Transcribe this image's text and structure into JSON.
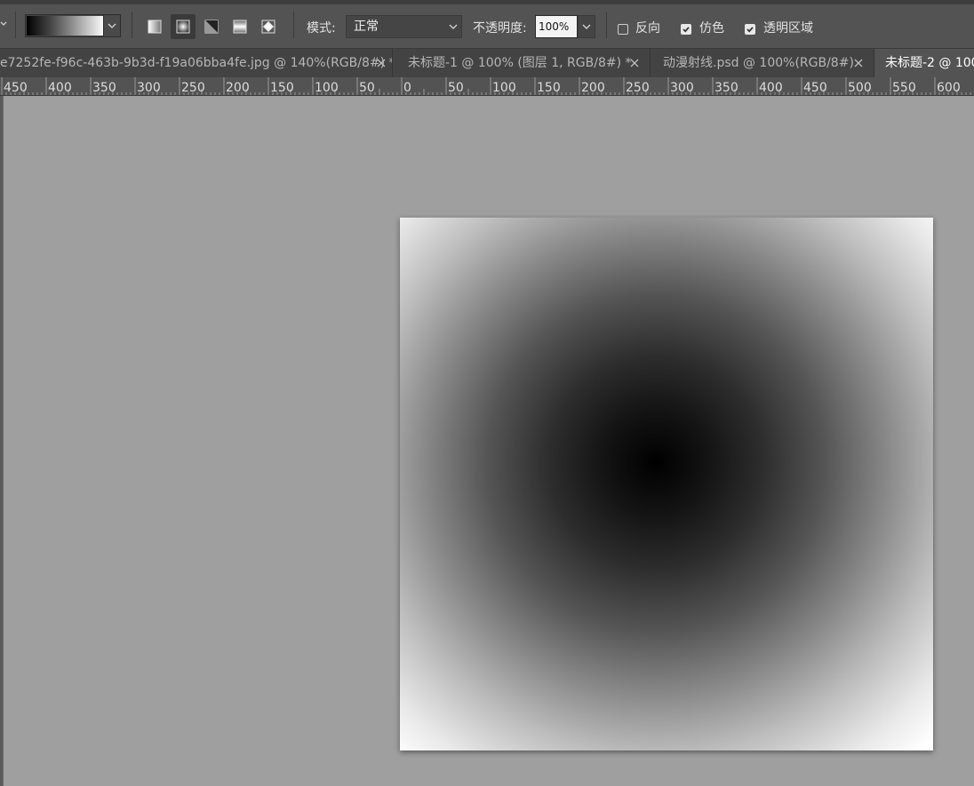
{
  "options_bar": {
    "gradient_types": [
      "linear",
      "radial",
      "angle",
      "reflected",
      "diamond"
    ],
    "active_gradient_type": "radial",
    "mode_label": "模式:",
    "mode_value": "正常",
    "opacity_label": "不透明度:",
    "opacity_value": "100%",
    "reverse_label": "反向",
    "reverse_checked": false,
    "dither_label": "仿色",
    "dither_checked": true,
    "transparency_label": "透明区域",
    "transparency_checked": true
  },
  "tabs": [
    {
      "title": "e7252fe-f96c-463b-9b3d-f19a06bba4fe.jpg @ 140%(RGB/8#) *",
      "active": false
    },
    {
      "title": "未标题-1 @ 100% (图层 1, RGB/8#) *",
      "active": false
    },
    {
      "title": "动漫射线.psd @ 100%(RGB/8#)",
      "active": false
    },
    {
      "title": "未标题-2 @ 100",
      "active": true
    }
  ],
  "ruler": {
    "labels": [
      "450",
      "400",
      "350",
      "300",
      "250",
      "200",
      "150",
      "100",
      "50",
      "0",
      "50",
      "100",
      "150",
      "200",
      "250",
      "300",
      "350",
      "400",
      "450",
      "500",
      "550",
      "600"
    ]
  },
  "colors": {
    "workspace": "#9f9f9f",
    "panel": "#535353",
    "tab_bar": "#434343"
  }
}
